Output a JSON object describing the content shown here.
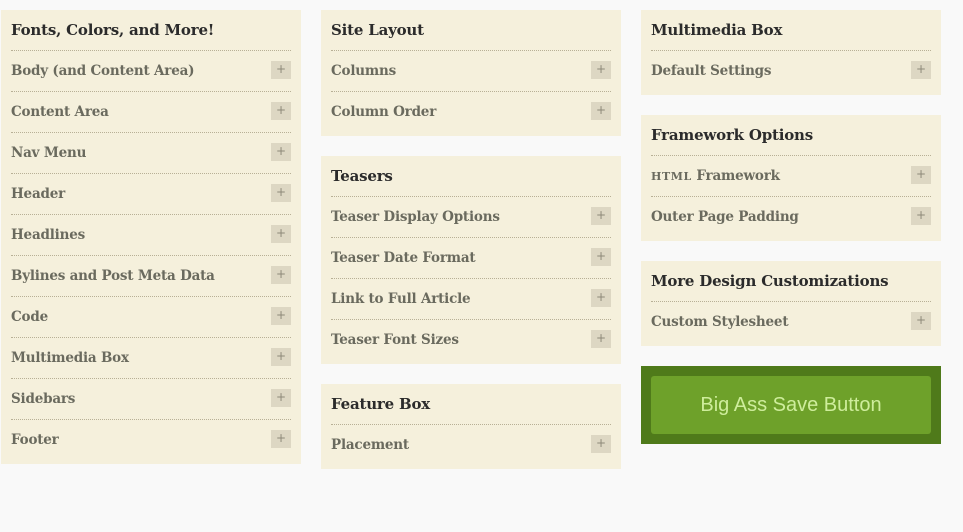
{
  "panels": {
    "fonts": {
      "title": "Fonts, Colors, and More!",
      "items": [
        {
          "label": "Body (and Content Area)"
        },
        {
          "label": "Content Area"
        },
        {
          "label": "Nav Menu"
        },
        {
          "label": "Header"
        },
        {
          "label": "Headlines"
        },
        {
          "label": "Bylines and Post Meta Data"
        },
        {
          "label": "Code"
        },
        {
          "label": "Multimedia Box"
        },
        {
          "label": "Sidebars"
        },
        {
          "label": "Footer"
        }
      ]
    },
    "site_layout": {
      "title": "Site Layout",
      "items": [
        {
          "label": "Columns"
        },
        {
          "label": "Column Order"
        }
      ]
    },
    "teasers": {
      "title": "Teasers",
      "items": [
        {
          "label": "Teaser Display Options"
        },
        {
          "label": "Teaser Date Format"
        },
        {
          "label": "Link to Full Article"
        },
        {
          "label": "Teaser Font Sizes"
        }
      ]
    },
    "feature_box": {
      "title": "Feature Box",
      "items": [
        {
          "label": "Placement"
        }
      ]
    },
    "multimedia_box": {
      "title": "Multimedia Box",
      "items": [
        {
          "label": "Default Settings"
        }
      ]
    },
    "framework_options": {
      "title": "Framework Options",
      "items": [
        {
          "label_caps": "HTML",
          "label_rest": " Framework"
        },
        {
          "label": "Outer Page Padding"
        }
      ]
    },
    "more_design": {
      "title": "More Design Customizations",
      "items": [
        {
          "label": "Custom Stylesheet"
        }
      ]
    }
  },
  "expand_symbol": "+",
  "save_button": {
    "label": "Big Ass Save Button"
  },
  "colors": {
    "panel_bg": "#f5f0dc",
    "title_text": "#2b2b2b",
    "item_text": "#6a6a5e",
    "plus_bg": "#ddd7c3",
    "save_outer": "#4f7a1a",
    "save_button_bg": "#6ea12a",
    "save_button_text": "#ceed9c"
  }
}
